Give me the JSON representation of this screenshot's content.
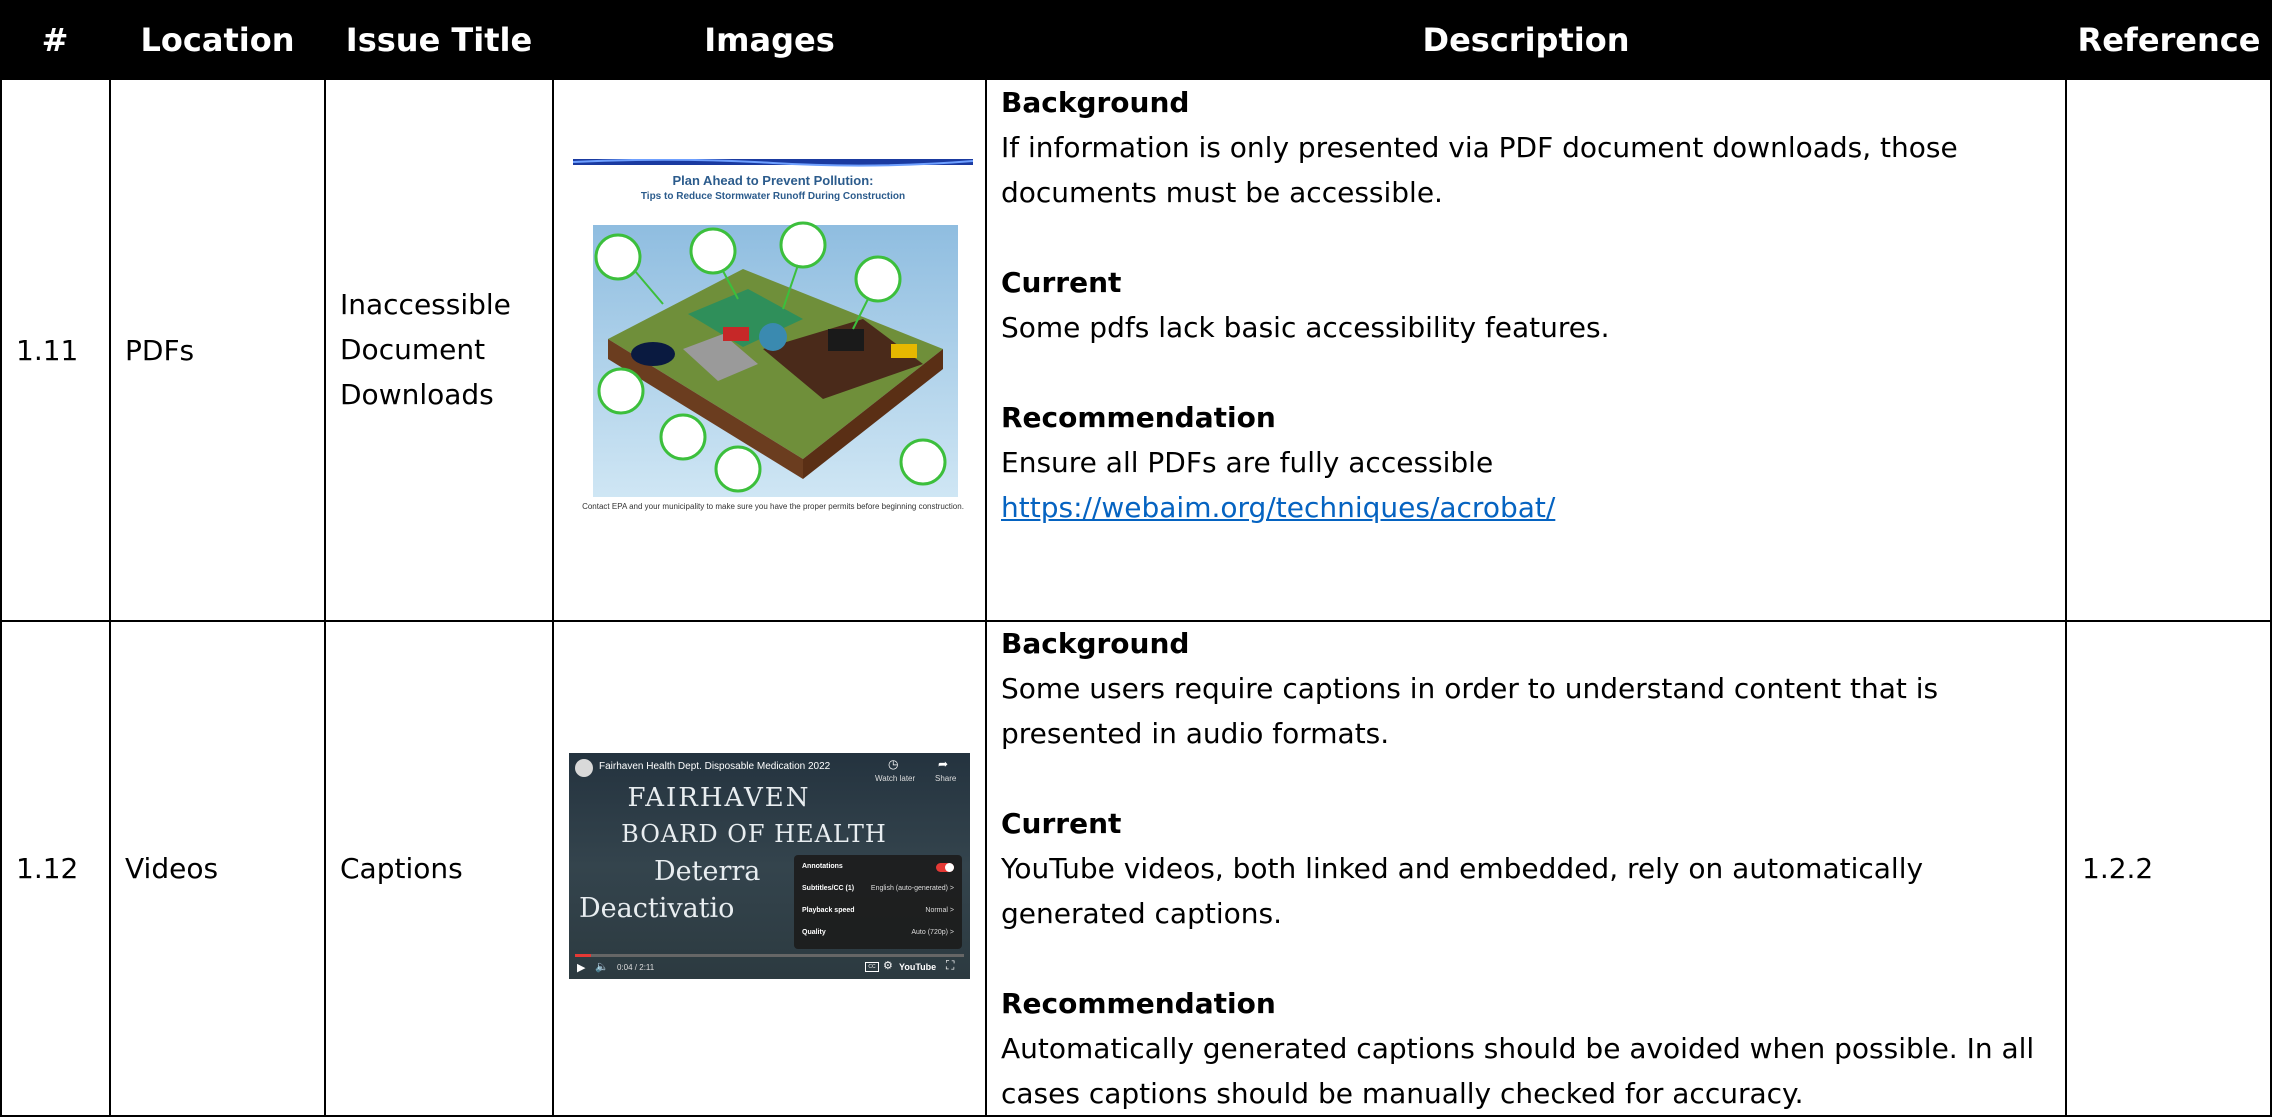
{
  "headers": [
    "#",
    "Location",
    "Issue Title",
    "Images",
    "Description",
    "Reference"
  ],
  "rows": [
    {
      "num": "1.11",
      "location": "PDFs",
      "title": "Inaccessible Document Downloads",
      "reference": "",
      "image": {
        "title": "Plan Ahead to Prevent Pollution:",
        "subtitle": "Tips to Reduce Stormwater Runoff During Construction",
        "footer": "Contact EPA and your municipality to make sure you have the proper permits before beginning construction."
      },
      "desc": {
        "bg_h": "Background",
        "bg": "If information is only presented via PDF document downloads, those documents must be accessible.",
        "cur_h": "Current",
        "cur": "Some pdfs lack basic accessibility features.",
        "rec_h": "Recommendation",
        "rec": "Ensure all PDFs are fully accessible",
        "link": "https://webaim.org/techniques/acrobat/"
      }
    },
    {
      "num": "1.12",
      "location": "Videos",
      "title": "Captions",
      "reference": "1.2.2",
      "image": {
        "video_title": "Fairhaven Health Dept. Disposable Medication 2022",
        "watch_later": "Watch later",
        "share": "Share",
        "line1": "FAIRHAVEN",
        "line2": "BOARD OF HEALTH",
        "line3": "Deterra",
        "line4": "Deactivatio",
        "menu": [
          {
            "label": "Annotations",
            "value": ""
          },
          {
            "label": "Subtitles/CC (1)",
            "value": "English (auto-generated) >"
          },
          {
            "label": "Playback speed",
            "value": "Normal >"
          },
          {
            "label": "Quality",
            "value": "Auto (720p) >"
          }
        ],
        "time": "0:04 / 2:11",
        "brand": "YouTube"
      },
      "desc": {
        "bg_h": "Background",
        "bg": "Some users require captions in order to understand content that is presented in audio formats.",
        "cur_h": "Current",
        "cur": "YouTube videos, both linked and embedded, rely on automatically generated captions.",
        "rec_h": "Recommendation",
        "rec": "Automatically generated captions should be avoided when possible. In all cases captions should be manually checked for accuracy."
      }
    }
  ]
}
